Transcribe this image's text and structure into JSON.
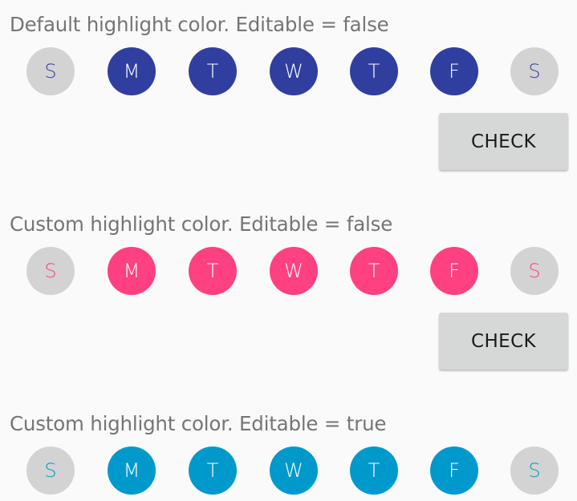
{
  "sections": [
    {
      "title": "Default highlight color. Editable = false",
      "highlight_color": "#303f9f",
      "editable": false,
      "days": [
        {
          "label": "S",
          "selected": false
        },
        {
          "label": "M",
          "selected": true
        },
        {
          "label": "T",
          "selected": true
        },
        {
          "label": "W",
          "selected": true
        },
        {
          "label": "T",
          "selected": true
        },
        {
          "label": "F",
          "selected": true
        },
        {
          "label": "S",
          "selected": false
        }
      ],
      "check_label": "CHECK"
    },
    {
      "title": "Custom highlight color. Editable = false",
      "highlight_color": "#ff4081",
      "editable": false,
      "days": [
        {
          "label": "S",
          "selected": false
        },
        {
          "label": "M",
          "selected": true
        },
        {
          "label": "T",
          "selected": true
        },
        {
          "label": "W",
          "selected": true
        },
        {
          "label": "T",
          "selected": true
        },
        {
          "label": "F",
          "selected": true
        },
        {
          "label": "S",
          "selected": false
        }
      ],
      "check_label": "CHECK"
    },
    {
      "title": "Custom highlight color. Editable = true",
      "highlight_color": "#0099cc",
      "editable": true,
      "days": [
        {
          "label": "S",
          "selected": false
        },
        {
          "label": "M",
          "selected": true
        },
        {
          "label": "T",
          "selected": true
        },
        {
          "label": "W",
          "selected": true
        },
        {
          "label": "T",
          "selected": true
        },
        {
          "label": "F",
          "selected": true
        },
        {
          "label": "S",
          "selected": false
        }
      ]
    }
  ],
  "colors": {
    "background": "#fafafa",
    "unselected_day": "#d3d3d3",
    "heading_text": "#757575",
    "button_background": "#d6d7d7"
  }
}
